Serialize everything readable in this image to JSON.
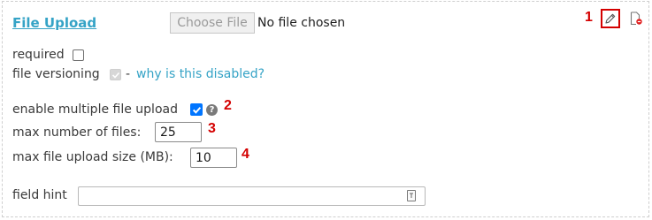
{
  "field": {
    "title": "File Upload",
    "choose_file_label": "Choose File",
    "no_file_text": "No file chosen"
  },
  "options": {
    "required_label": "required",
    "required_checked": false,
    "versioning_label": "file versioning",
    "versioning_checked": true,
    "versioning_disabled": true,
    "versioning_separator": "-",
    "why_disabled_link": "why is this disabled?",
    "multiple_label": "enable multiple file upload",
    "multiple_checked": true,
    "max_files_label": "max number of files:",
    "max_files_value": "25",
    "max_size_label": "max file upload size (MB):",
    "max_size_value": "10",
    "hint_label": "field hint",
    "hint_value": ""
  },
  "callouts": {
    "c1": "1",
    "c2": "2",
    "c3": "3",
    "c4": "4"
  },
  "icons": {
    "edit": "pencil-icon",
    "remove": "remove-document-icon",
    "help": "question-icon",
    "hint": "text-field-icon"
  },
  "colors": {
    "link": "#35a3c6",
    "callout": "#d40000",
    "checkbox_checked": "#0075ff"
  }
}
